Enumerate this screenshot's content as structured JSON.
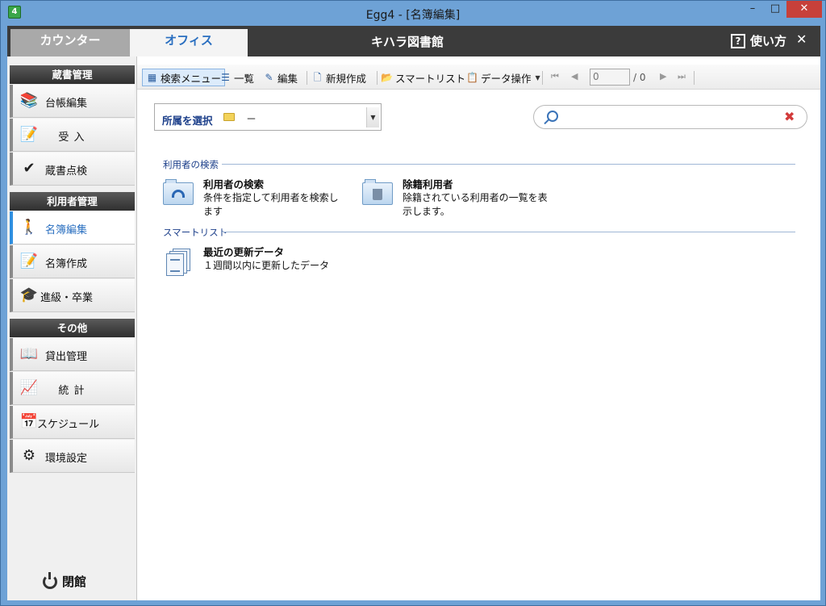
{
  "window": {
    "title": "Egg4 - [名簿編集]",
    "icon_label": "4",
    "minimize": "–",
    "maximize": "□",
    "close": "✕"
  },
  "tabs": {
    "counter": "カウンター",
    "office": "オフィス",
    "library_name": "キハラ図書館",
    "help": "使い方",
    "help_icon": "?",
    "close": "✕"
  },
  "sidebar": {
    "sections": [
      {
        "header": "蔵書管理",
        "items": [
          {
            "label": "台帳編集",
            "icon": "books-icon"
          },
          {
            "label": "受 入",
            "icon": "document-pen-icon"
          },
          {
            "label": "蔵書点検",
            "icon": "checkmark-icon"
          }
        ]
      },
      {
        "header": "利用者管理",
        "items": [
          {
            "label": "名簿編集",
            "icon": "people-walking-icon",
            "active": true
          },
          {
            "label": "名簿作成",
            "icon": "document-pen-icon"
          },
          {
            "label": "進級・卒業",
            "icon": "graduate-icon"
          }
        ]
      },
      {
        "header": "その他",
        "items": [
          {
            "label": "貸出管理",
            "icon": "open-book-icon"
          },
          {
            "label": "統 計",
            "icon": "chart-icon"
          },
          {
            "label": "スケジュール",
            "icon": "calendar-icon"
          },
          {
            "label": "環境設定",
            "icon": "gear-icon"
          }
        ]
      }
    ],
    "close_library": "閉館"
  },
  "toolbar": {
    "search_menu": "検索メニュー",
    "list": "一覧",
    "edit": "編集",
    "new": "新規作成",
    "smart_list": "スマートリスト",
    "data_ops": "データ操作",
    "page_current": "0",
    "page_total": "/ 0"
  },
  "filter": {
    "affiliation_label": "所属を選択",
    "affiliation_value": "－"
  },
  "search": {
    "placeholder": ""
  },
  "groups": [
    {
      "title": "利用者の検索",
      "entries": [
        {
          "title": "利用者の検索",
          "desc": "条件を指定して利用者を検索します",
          "icon": "folder-search-icon"
        },
        {
          "title": "除籍利用者",
          "desc": "除籍されている利用者の一覧を表示します。",
          "icon": "folder-trash-icon"
        }
      ]
    },
    {
      "title": "スマートリスト",
      "entries": [
        {
          "title": "最近の更新データ",
          "desc": "１週間以内に更新したデータ",
          "icon": "documents-icon"
        }
      ]
    }
  ]
}
